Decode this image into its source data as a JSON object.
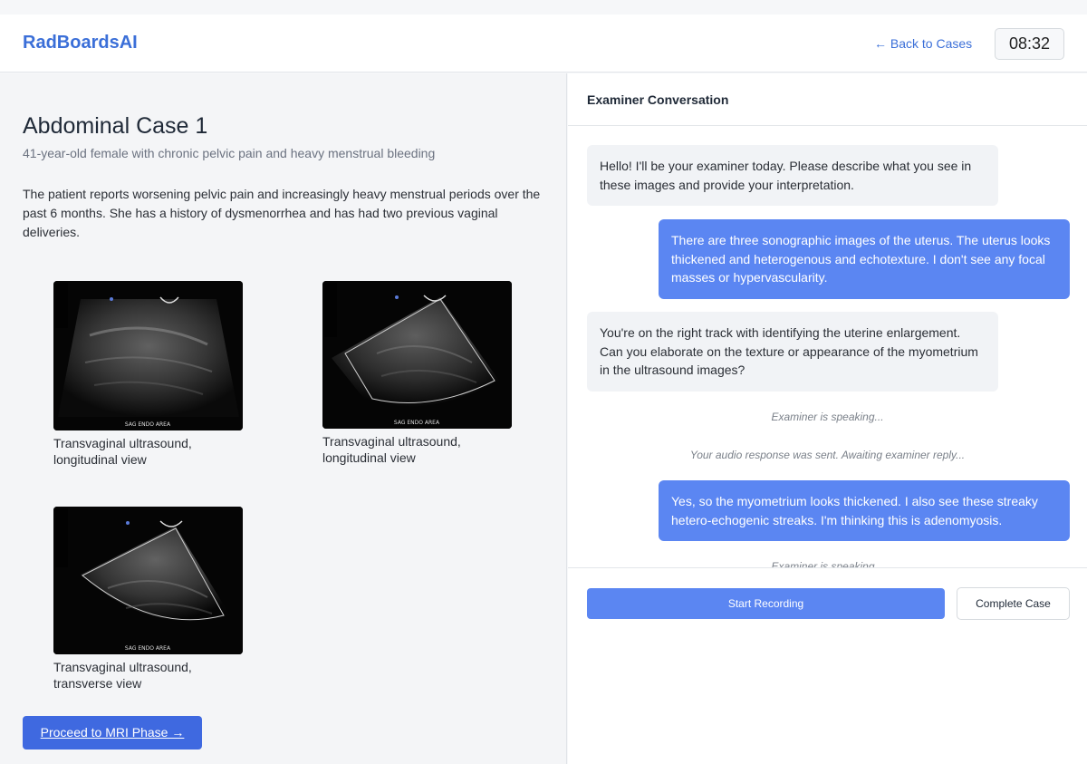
{
  "app": {
    "title": "RadBoardsAI",
    "back_label": "← Back to Cases",
    "timer": "08:32"
  },
  "case": {
    "title": "Abdominal Case 1",
    "subtitle": "41-year-old female with chronic pelvic pain and heavy menstrual bleeding",
    "description": "The patient reports worsening pelvic pain and increasingly heavy menstrual periods over the past 6 months. She has a history of dysmenorrhea and has had two previous vaginal deliveries.",
    "images": [
      {
        "caption_line1": "Transvaginal ultrasound,",
        "caption_line2": "longitudinal view",
        "overlay_label": "SAG ENDO AREA"
      },
      {
        "caption_line1": "Transvaginal ultrasound,",
        "caption_line2": "longitudinal view",
        "overlay_label": "SAG ENDO AREA"
      },
      {
        "caption_line1": "Transvaginal ultrasound,",
        "caption_line2": "transverse view",
        "overlay_label": "SAG ENDO AREA"
      }
    ],
    "next_phase_label": "Proceed to MRI Phase →"
  },
  "conversation": {
    "title": "Examiner Conversation",
    "messages": [
      {
        "role": "examiner",
        "text": "Hello! I'll be your examiner today. Please describe what you see in these images and provide your interpretation."
      },
      {
        "role": "user",
        "text": "There are three sonographic images of the uterus. The uterus looks thickened and heterogenous and echotexture. I don't see any focal masses or hypervascularity."
      },
      {
        "role": "examiner",
        "text": "You're on the right track with identifying the uterine enlargement. Can you elaborate on the texture or appearance of the myometrium in the ultrasound images?"
      },
      {
        "role": "status",
        "text": "Examiner is speaking..."
      },
      {
        "role": "status",
        "text": "Your audio response was sent. Awaiting examiner reply..."
      },
      {
        "role": "user",
        "text": "Yes, so the myometrium looks thickened. I also see these streaky hetero-echogenic streaks. I'm thinking this is adenomyosis."
      },
      {
        "role": "status",
        "text": "Examiner is speaking..."
      }
    ],
    "record_label": "Start Recording",
    "complete_label": "Complete Case"
  },
  "colors": {
    "brand": "#3b6fd8",
    "user_bubble": "#5b86f2",
    "examiner_bubble": "#f1f3f6",
    "primary_button": "#3f69e0"
  }
}
